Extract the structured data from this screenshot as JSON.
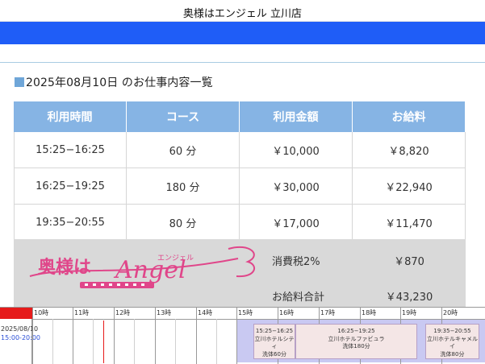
{
  "header": {
    "title": "奥様はエンジェル 立川店"
  },
  "section": {
    "title": "2025年08月10日 のお仕事内容一覧"
  },
  "table": {
    "columns": [
      "利用時間",
      "コース",
      "利用金額",
      "お給料"
    ],
    "rows": [
      [
        "15:25−16:25",
        "60 分",
        "￥10,000",
        "￥8,820"
      ],
      [
        "16:25−19:25",
        "180 分",
        "￥30,000",
        "￥22,940"
      ],
      [
        "19:35−20:55",
        "80 分",
        "￥17,000",
        "￥11,470"
      ]
    ]
  },
  "summary": {
    "tax_label": "消費税2%",
    "tax_value": "￥870",
    "total_label": "お給料合計",
    "total_value": "￥43,230"
  },
  "logo": {
    "brand_jp": "奥様は",
    "brand_en": "Angel",
    "brand_kana": "エンジェル"
  },
  "timeline": {
    "date": "2025/08/10",
    "range": "15:00-20:00",
    "hours": [
      "10時",
      "11時",
      "12時",
      "13時",
      "14時",
      "15時",
      "16時",
      "17時",
      "18時",
      "19時",
      "20時"
    ],
    "slots": [
      {
        "time": "15:25−16:25",
        "place": "立川ホテルシティ",
        "course": "洗体60分"
      },
      {
        "time": "16:25−19:25",
        "place": "立川ホテルファビュラ",
        "course": "洗体180分"
      },
      {
        "time": "19:35−20:55",
        "place": "立川ホテルキャメルイ",
        "course": "洗体80分"
      }
    ]
  },
  "colors": {
    "accent_blue": "#1f5df7",
    "table_header": "#86b4e4",
    "summary_bg": "#d9d9d9",
    "logo_pink": "#e0468a",
    "timeline_red": "#e61a1a",
    "booked": "#c9c9f2"
  }
}
